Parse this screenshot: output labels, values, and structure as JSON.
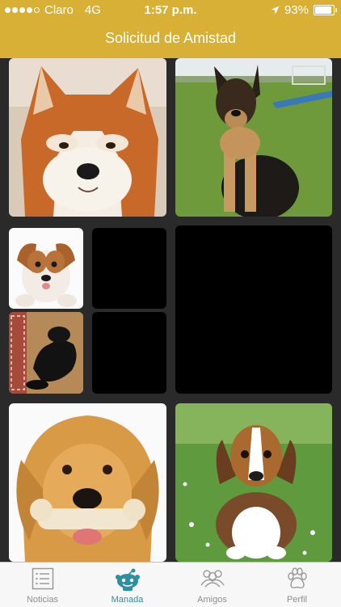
{
  "status_bar": {
    "carrier": "Claro",
    "network": "4G",
    "time": "1:57 p.m.",
    "battery": "93%",
    "battery_level": 0.93
  },
  "header": {
    "title": "Solicitud de Amistad"
  },
  "photos": [
    {
      "id": "akita",
      "subject": "akita-puppy"
    },
    {
      "id": "german-shepherd",
      "subject": "german-shepherd-puppy"
    },
    {
      "id": "jack-russell",
      "subject": "jack-russell-puppy"
    },
    {
      "id": "black-dog",
      "subject": "black-dog-on-rug"
    },
    {
      "id": "golden",
      "subject": "golden-retriever-with-bone"
    },
    {
      "id": "beagle",
      "subject": "beagle-puppy"
    }
  ],
  "tabs": [
    {
      "label": "Noticias",
      "icon": "news-list-icon",
      "active": false
    },
    {
      "label": "Manada",
      "icon": "pack-icon",
      "active": true
    },
    {
      "label": "Amigos",
      "icon": "friends-icon",
      "active": false
    },
    {
      "label": "Perfil",
      "icon": "paw-icon",
      "active": false
    }
  ],
  "colors": {
    "accent": "#d9b036",
    "active_tab": "#2f8fa0",
    "background": "#2a2a2a"
  }
}
